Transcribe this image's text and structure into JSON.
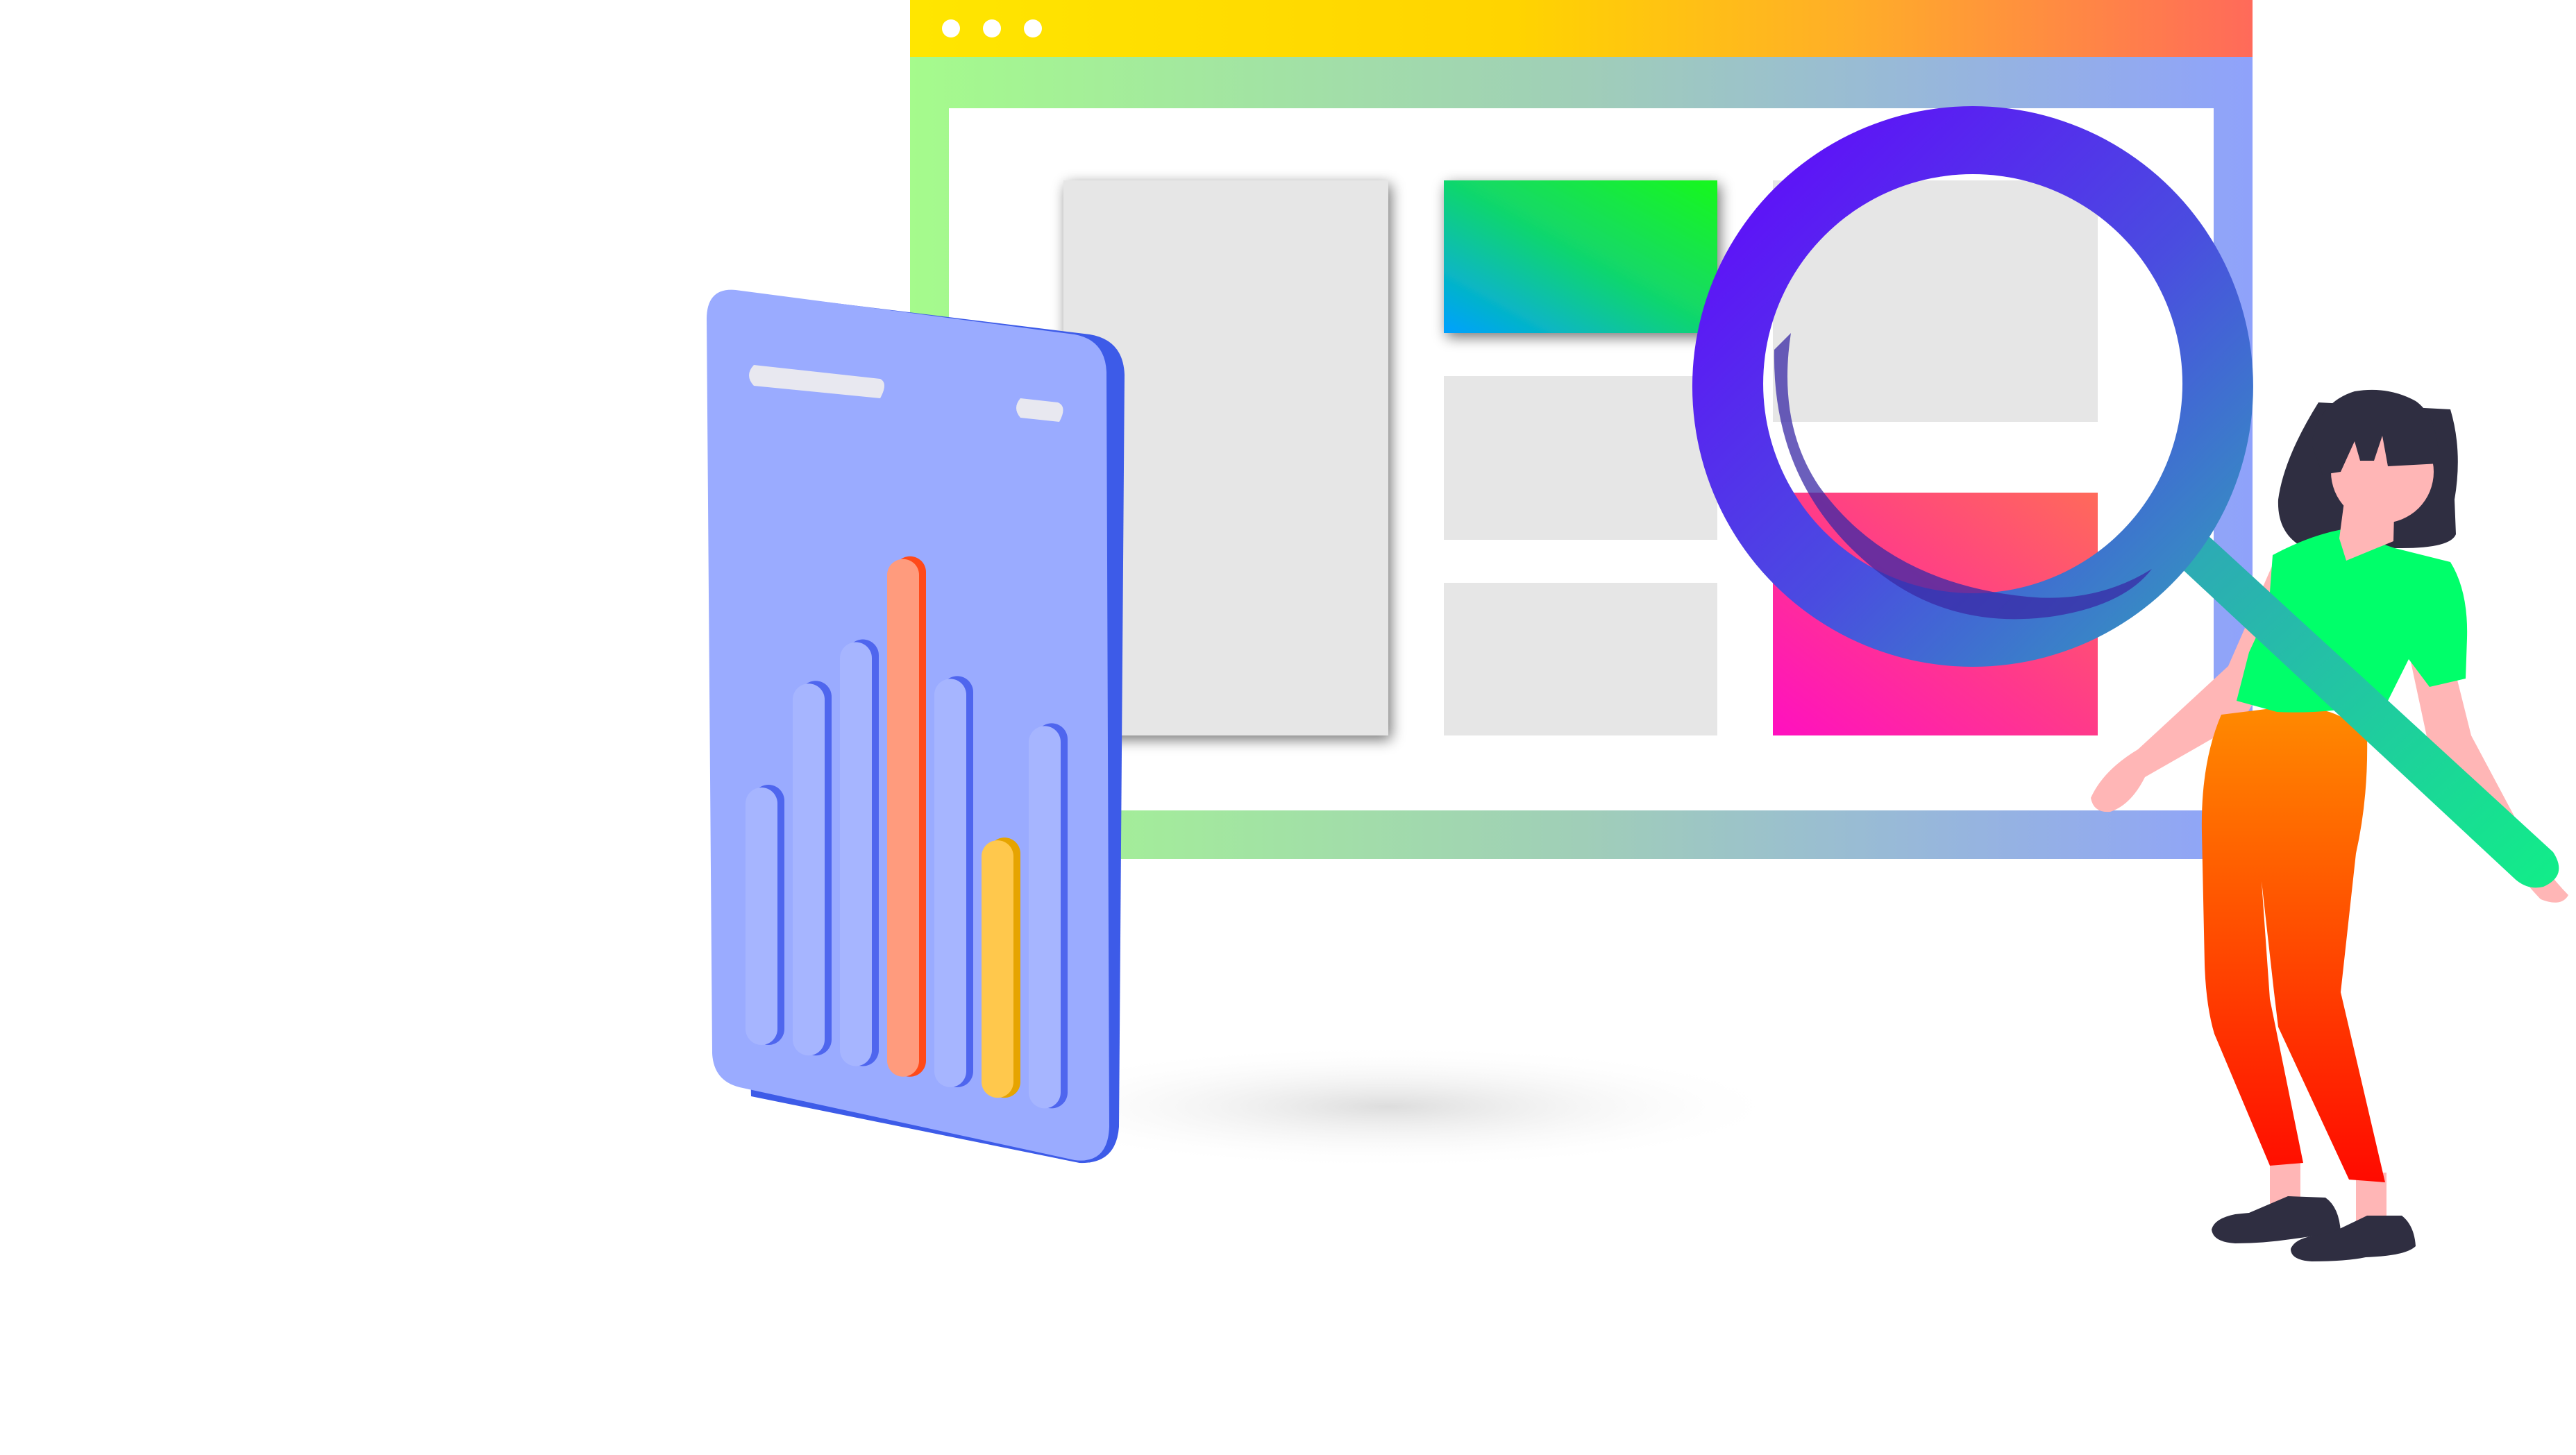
{
  "illustration": {
    "browser_window": {
      "title_bar_dots": 3,
      "title_bar_colors": [
        "#ffe600",
        "#ffae28",
        "#ff6a5a"
      ],
      "frame_colors": [
        "#a5fb8c",
        "#a0ceb8",
        "#8fa2fb"
      ],
      "placeholder_color": "#e6e6e6",
      "cards": [
        {
          "kind": "placeholder"
        },
        {
          "kind": "gradient",
          "colors": [
            "#00a0ff",
            "#11d66e",
            "#19f81c"
          ]
        },
        {
          "kind": "placeholder"
        },
        {
          "kind": "placeholder"
        },
        {
          "kind": "placeholder"
        },
        {
          "kind": "gradient",
          "colors": [
            "#ff1ab0",
            "#ff6a5a"
          ]
        }
      ]
    },
    "chart_card": {
      "card_color": "#9aabff",
      "card_edge_color": "#3d5be8",
      "bars": [
        {
          "level": 0.5,
          "color": "#a6b5ff"
        },
        {
          "level": 0.72,
          "color": "#a6b5ff"
        },
        {
          "level": 0.82,
          "color": "#a6b5ff"
        },
        {
          "level": 1.0,
          "color": "#ff9b7d"
        },
        {
          "level": 0.79,
          "color": "#a6b5ff"
        },
        {
          "level": 0.5,
          "color": "#ffc84c"
        },
        {
          "level": 0.74,
          "color": "#a6b5ff"
        }
      ]
    },
    "magnifier": {
      "ring_colors": [
        "#6400ff",
        "#2fa5b8"
      ],
      "handle_colors": [
        "#2fa5b8",
        "#11ee88"
      ]
    },
    "person": {
      "hair_color": "#2f2e41",
      "skin_color": "#ffb6b6",
      "shirt_color": "#00ff6a",
      "pants_colors": [
        "#ff8a00",
        "#ff0a00"
      ],
      "shoe_color": "#2f2e41"
    }
  }
}
